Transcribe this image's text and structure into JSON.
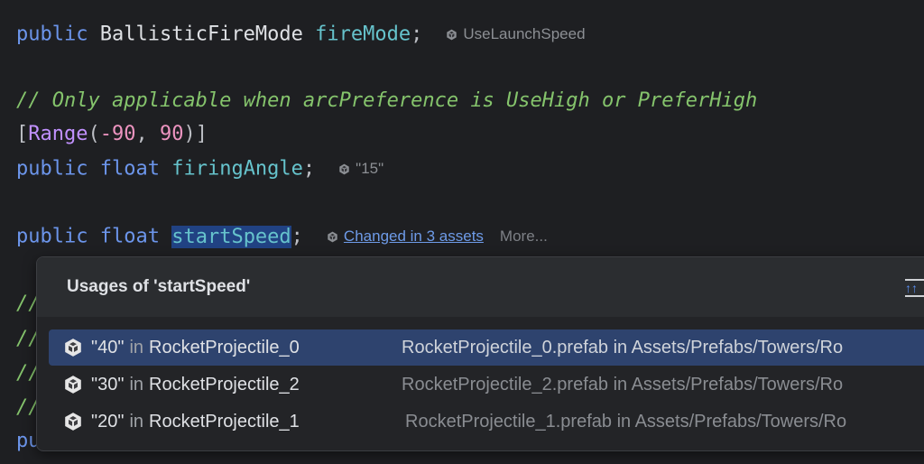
{
  "code": {
    "line1": {
      "kw": "public",
      "type": "BallisticFireMode",
      "field": "fireMode",
      "end": ";",
      "hint": "UseLaunchSpeed"
    },
    "comment1": "// Only applicable when arcPreference is UseHigh or PreferHigh",
    "range": {
      "open": "[",
      "name": "Range",
      "lp": "(",
      "a": "-90",
      "sep": ", ",
      "b": "90",
      "rp": ")",
      "close": "]"
    },
    "line3": {
      "kw": "public",
      "type": "float",
      "field": "firingAngle",
      "end": ";",
      "hint": "\"15\""
    },
    "line4": {
      "kw": "public",
      "type": "float",
      "field": "startSpeed",
      "end": ";",
      "hint_link": "Changed in 3 assets",
      "more": "More..."
    },
    "partial_comments": [
      "//",
      "//",
      "//",
      "//"
    ],
    "partial_last": "pu"
  },
  "popup": {
    "title": "Usages of 'startSpeed'",
    "pin_icon": "expand-icon",
    "in_label": "in",
    "items": [
      {
        "value": "\"40\"",
        "object": "RocketProjectile_0",
        "location": "RocketProjectile_0.prefab in Assets/Prefabs/Towers/Ro",
        "selected": true
      },
      {
        "value": "\"30\"",
        "object": "RocketProjectile_2",
        "location": "RocketProjectile_2.prefab in Assets/Prefabs/Towers/Ro",
        "selected": false
      },
      {
        "value": "\"20\"",
        "object": "RocketProjectile_1",
        "location": "RocketProjectile_1.prefab in Assets/Prefabs/Towers/Ro",
        "selected": false
      }
    ]
  },
  "colors": {
    "background": "#1e1f22",
    "keyword": "#6c95eb",
    "field": "#66c3cc",
    "comment": "#85c46c",
    "number": "#ed94c0",
    "attribute": "#c191ff",
    "selection": "#2e436e",
    "link": "#6e9be8"
  }
}
